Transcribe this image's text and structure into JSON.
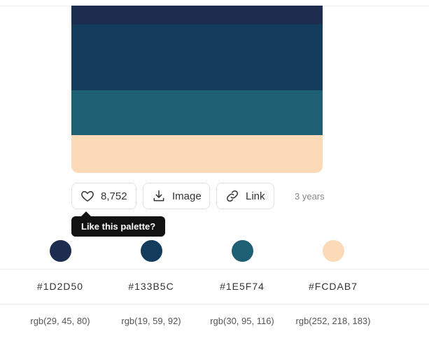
{
  "palette": {
    "colors": [
      {
        "hex_label": "#1D2D50",
        "rgb_label": "rgb(29, 45, 80)",
        "color": "#1D2D50",
        "share": 0.12
      },
      {
        "hex_label": "#133B5C",
        "rgb_label": "rgb(19, 59, 92)",
        "color": "#133B5C",
        "share": 0.4
      },
      {
        "hex_label": "#1E5F74",
        "rgb_label": "rgb(30, 95, 116)",
        "color": "#1E5F74",
        "share": 0.27
      },
      {
        "hex_label": "#FCDAB7",
        "rgb_label": "rgb(252, 218, 183)",
        "color": "#FCDAB7",
        "share": 0.21
      }
    ]
  },
  "actions": {
    "like_count": "8,752",
    "image_label": "Image",
    "link_label": "Link",
    "age": "3 years",
    "icons": [
      "heart-icon",
      "download-icon",
      "link-icon"
    ]
  },
  "tooltip": {
    "text": "Like this palette?"
  }
}
